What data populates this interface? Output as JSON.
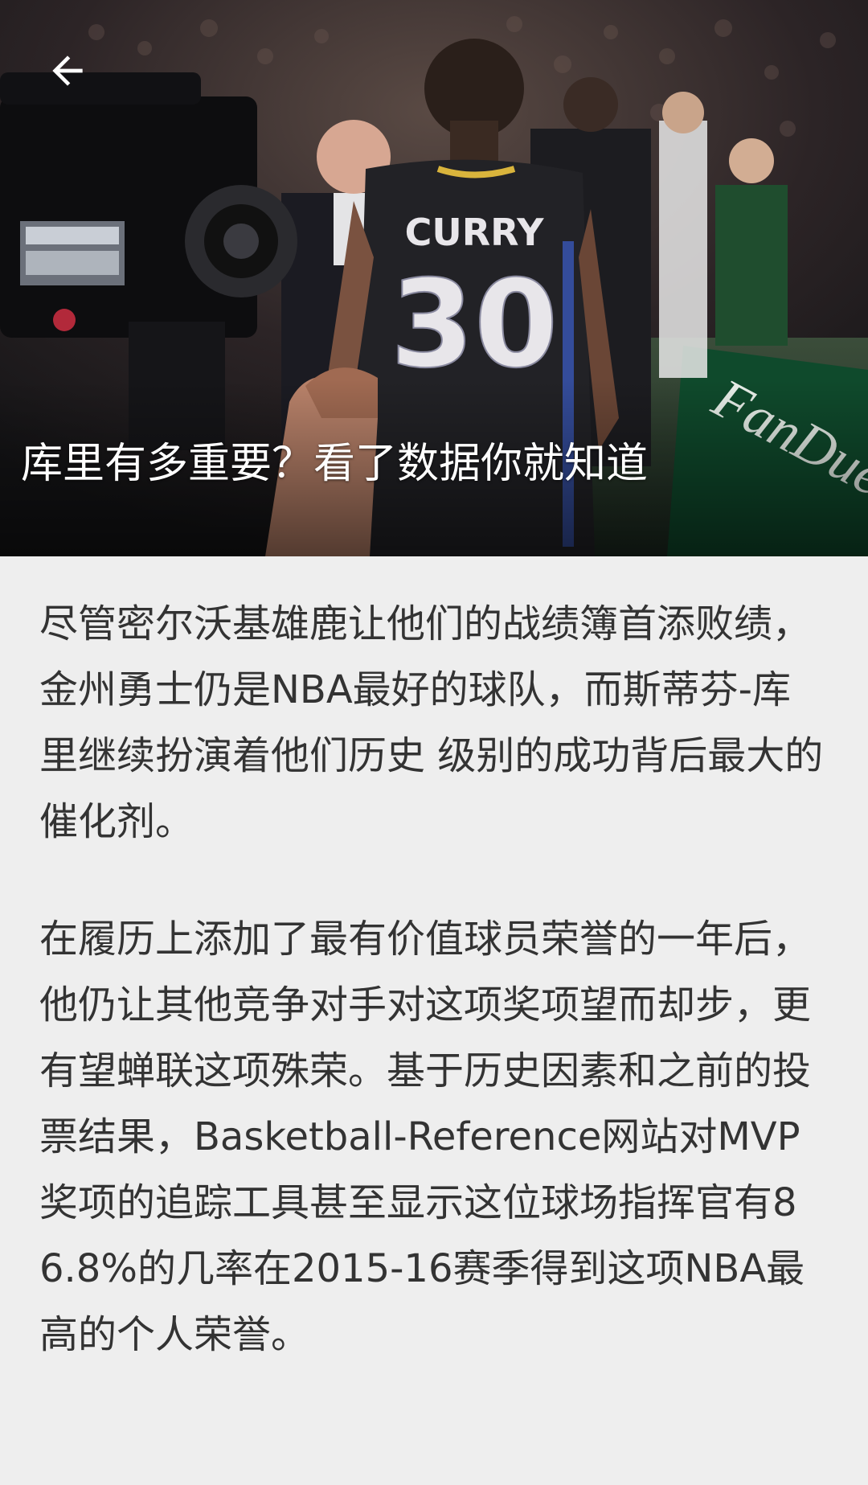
{
  "header": {
    "back_icon": "arrow-left-icon",
    "title": "库里有多重要？看了数据你就知道"
  },
  "hero_image": {
    "jersey_name": "CURRY",
    "jersey_number": "30",
    "banner_text": "FanDuel",
    "colors": {
      "jersey": "#222226",
      "number_fill": "#e8e6ea",
      "banner": "#0f4a2c"
    }
  },
  "article": {
    "paragraphs": [
      "尽管密尔沃基雄鹿让他们的战绩簿首添败绩，金州勇士仍是NBA最好的球队，而斯蒂芬-库里继续扮演着他们历史 级别的成功背后最大的催化剂。",
      "在履历上添加了最有价值球员荣誉的一年后，他仍让其他竞争对手对这项奖项望而却步，更有望蝉联这项殊荣。基于历史因素和之前的投票结果，Basketball-Reference网站对MVP奖项的追踪工具甚至显示这位球场指挥官有86.8%的几率在2015-16赛季得到这项NBA最高的个人荣誉。"
    ]
  },
  "colors": {
    "page_background": "#eeeeee",
    "body_text": "#333333",
    "title_text": "#ffffff"
  }
}
